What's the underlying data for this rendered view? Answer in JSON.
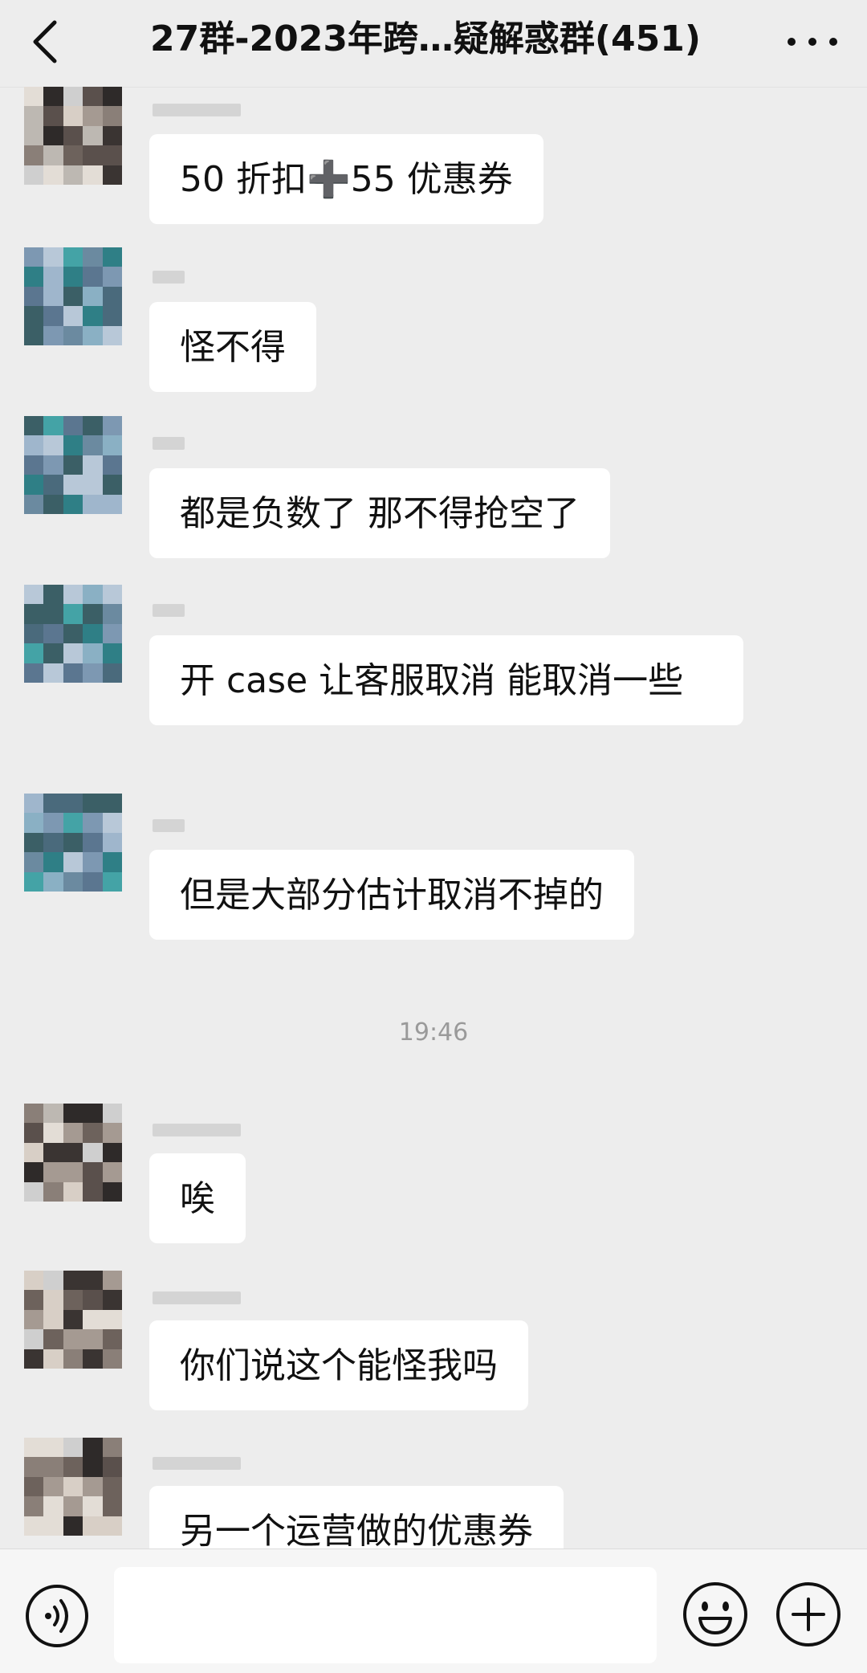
{
  "header": {
    "title": "27群-2023年跨…疑解惑群(451)",
    "back_icon": "chevron-left-icon",
    "more_icon": "more-dots-icon"
  },
  "messages": [
    {
      "text": "50 折扣➕55 优惠券",
      "avatar": "avatar-a"
    },
    {
      "text": "怪不得",
      "avatar": "avatar-b"
    },
    {
      "text": "都是负数了  那不得抢空了",
      "avatar": "avatar-b"
    },
    {
      "text": "开 case 让客服取消  能取消一些",
      "avatar": "avatar-b"
    },
    {
      "text": "但是大部分估计取消不掉的",
      "avatar": "avatar-b"
    },
    {
      "text": "唉",
      "avatar": "avatar-a"
    },
    {
      "text": "你们说这个能怪我吗",
      "avatar": "avatar-a"
    },
    {
      "text": "另一个运营做的优惠券",
      "avatar": "avatar-a"
    }
  ],
  "timestamp": "19:46",
  "input_bar": {
    "voice_icon": "voice-icon",
    "message_value": "",
    "emoji_icon": "emoji-icon",
    "plus_icon": "plus-icon"
  },
  "colors": {
    "background": "#ededed",
    "bubble": "#ffffff",
    "text": "#111111",
    "timestamp": "#9a9a9a"
  }
}
